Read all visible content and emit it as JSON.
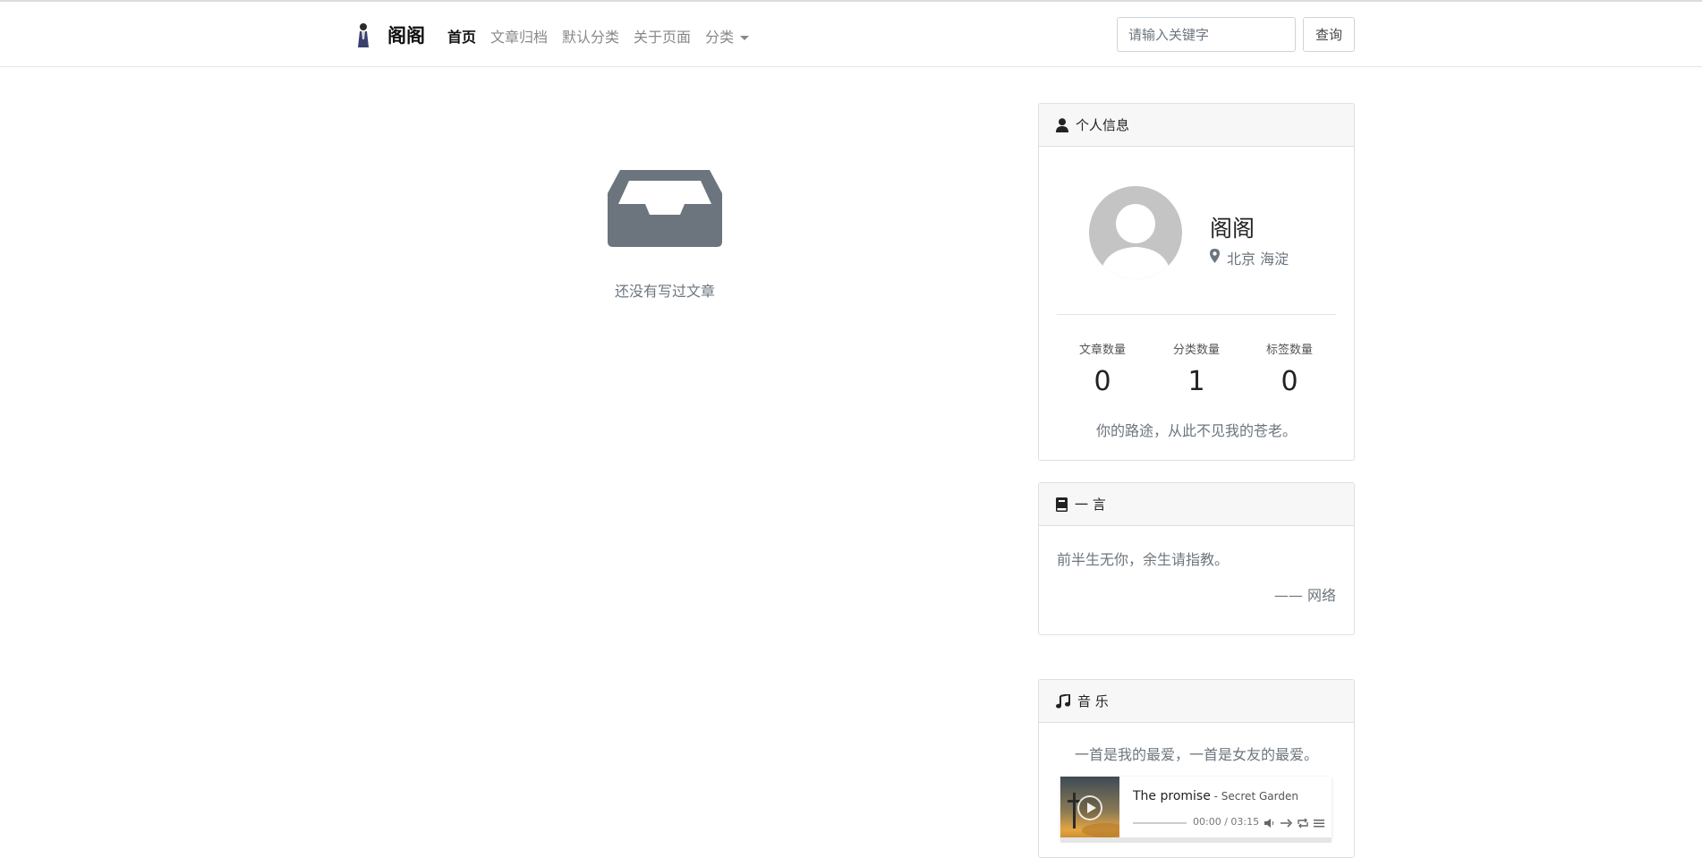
{
  "brand": {
    "name": "阁阁"
  },
  "nav": {
    "items": [
      {
        "label": "首页",
        "active": true
      },
      {
        "label": "文章归档",
        "active": false
      },
      {
        "label": "默认分类",
        "active": false
      },
      {
        "label": "关于页面",
        "active": false
      },
      {
        "label": "分类",
        "active": false,
        "dropdown": true
      }
    ]
  },
  "search": {
    "placeholder": "请输入关键字",
    "button_label": "查询"
  },
  "main": {
    "empty_icon": "inbox-icon",
    "empty_text": "还没有写过文章"
  },
  "profile_card": {
    "title": "个人信息",
    "icon": "user-icon",
    "name": "阁阁",
    "location_icon": "map-marker-icon",
    "location": "北京 海淀",
    "stats": [
      {
        "label": "文章数量",
        "value": "0"
      },
      {
        "label": "分类数量",
        "value": "1"
      },
      {
        "label": "标签数量",
        "value": "0"
      }
    ],
    "motto": "你的路途，从此不见我的苍老。"
  },
  "quote_card": {
    "title": "一 言",
    "icon": "book-icon",
    "text": "前半生无你，余生请指教。",
    "source": "—— 网络"
  },
  "music_card": {
    "title": "音 乐",
    "icon": "music-note-icon",
    "description": "一首是我的最爱，一首是女友的最爱。",
    "player": {
      "song": "The promise",
      "artist": " - Secret Garden",
      "time": "00:00 / 03:15",
      "progress": 0
    }
  },
  "colors": {
    "icon_gray": "#6c757d",
    "header_bg": "#f7f7f7",
    "border": "#dfdfdf"
  }
}
